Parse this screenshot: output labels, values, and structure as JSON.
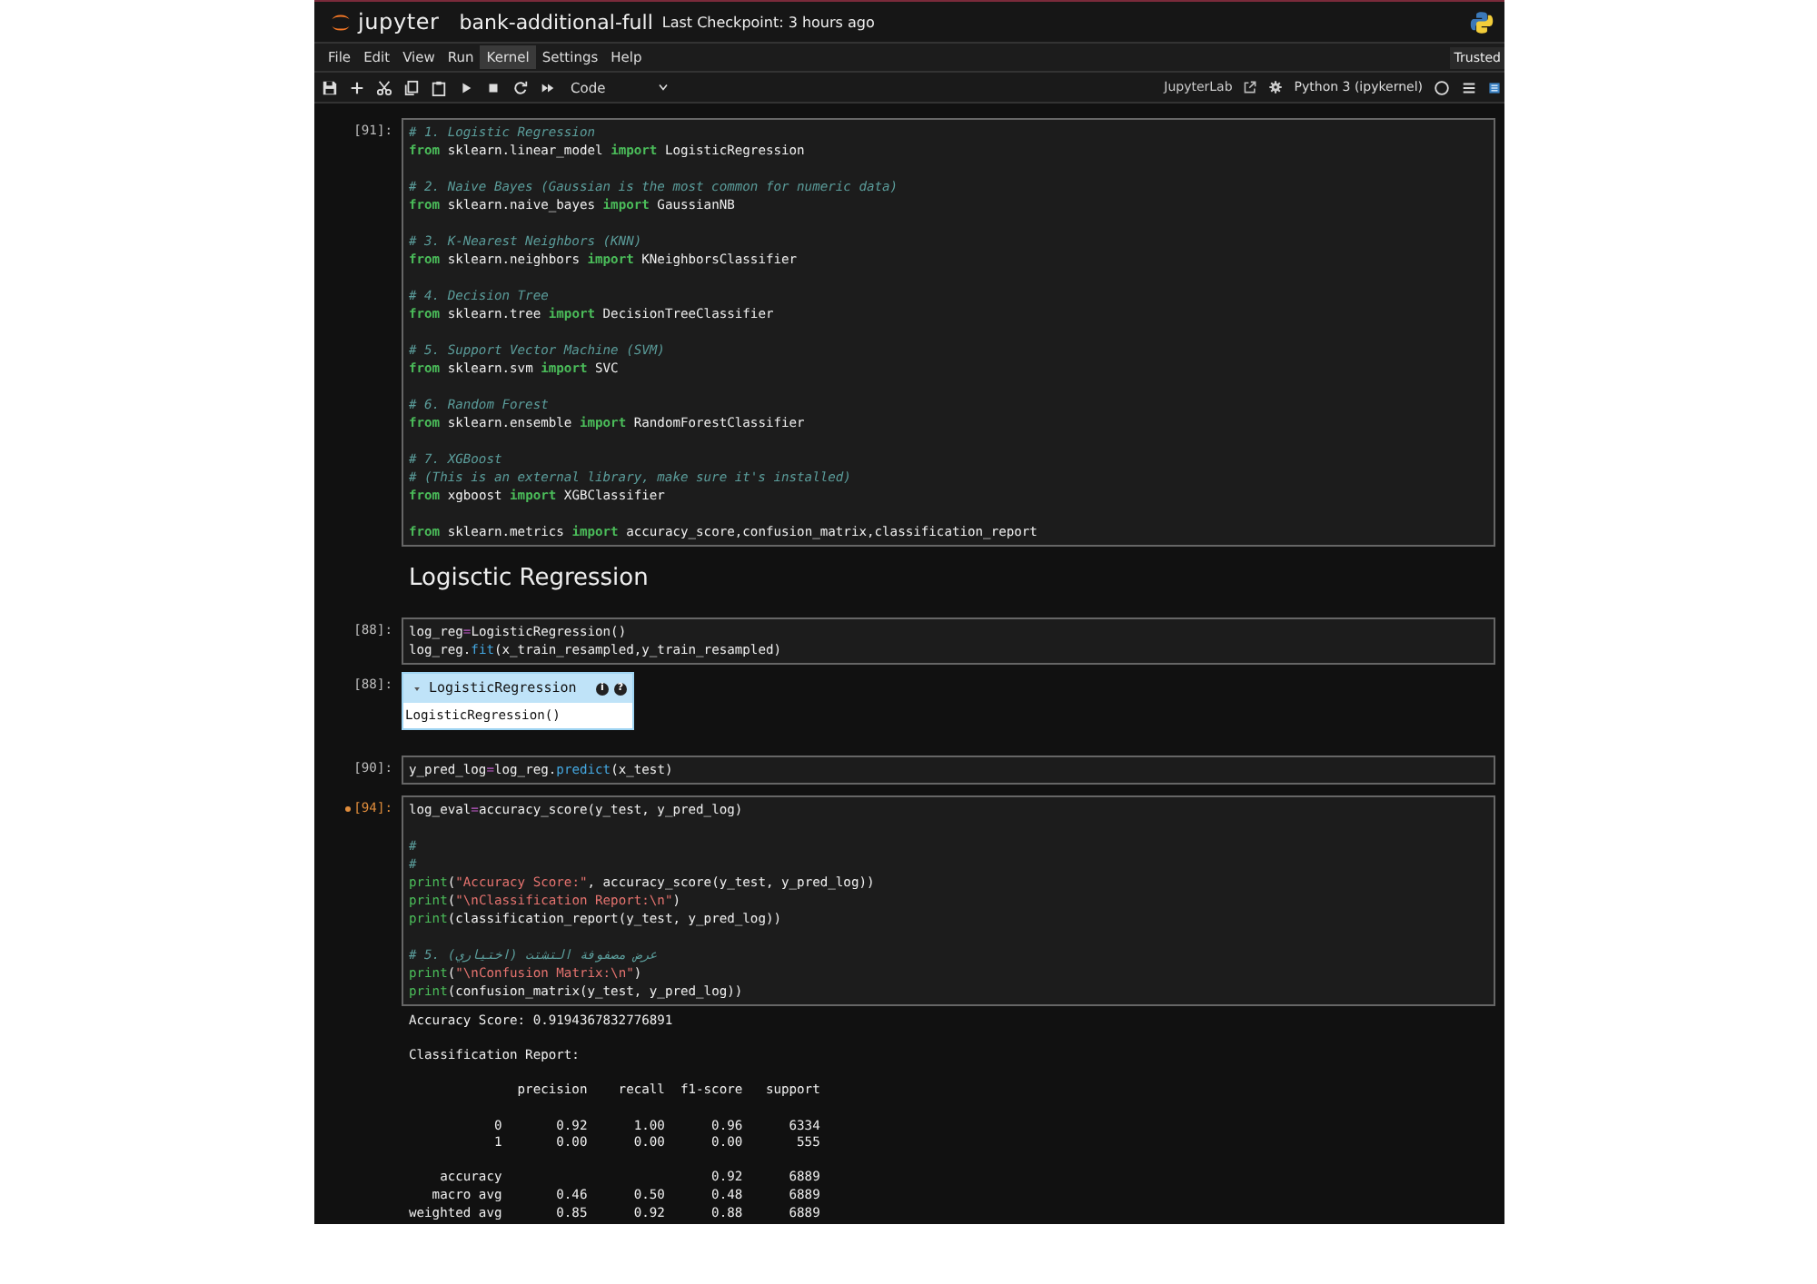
{
  "header": {
    "logo_text": "jupyter",
    "notebook_name": "bank-additional-full",
    "checkpoint": "Last Checkpoint: 3 hours ago"
  },
  "menu": [
    {
      "label": "File",
      "selected": false
    },
    {
      "label": "Edit",
      "selected": false
    },
    {
      "label": "View",
      "selected": false
    },
    {
      "label": "Run",
      "selected": false
    },
    {
      "label": "Kernel",
      "selected": true
    },
    {
      "label": "Settings",
      "selected": false
    },
    {
      "label": "Help",
      "selected": false
    }
  ],
  "trusted": "Trusted",
  "toolbar": {
    "cell_type": "Code",
    "jupyterlab_link": "JupyterLab",
    "kernel": "Python 3 (ipykernel)"
  },
  "cells": [
    {
      "kind": "code",
      "prompt": "[91]:",
      "modified": false,
      "blocks": [
        [
          [
            {
              "kind": "cm",
              "text": "# 1. Logistic Regression"
            }
          ],
          [
            {
              "kind": "kw",
              "text": "from"
            },
            {
              "kind": "pl",
              "text": " sklearn.linear_model "
            },
            {
              "kind": "kw",
              "text": "import"
            },
            {
              "kind": "pl",
              "text": " LogisticRegression"
            }
          ]
        ],
        [
          [
            {
              "kind": "cm",
              "text": "# 2. Naive Bayes (Gaussian is the most common for numeric data)"
            }
          ],
          [
            {
              "kind": "kw",
              "text": "from"
            },
            {
              "kind": "pl",
              "text": " sklearn.naive_bayes "
            },
            {
              "kind": "kw",
              "text": "import"
            },
            {
              "kind": "pl",
              "text": " GaussianNB"
            }
          ]
        ],
        [
          [
            {
              "kind": "cm",
              "text": "# 3. K-Nearest Neighbors (KNN)"
            }
          ],
          [
            {
              "kind": "kw",
              "text": "from"
            },
            {
              "kind": "pl",
              "text": " sklearn.neighbors "
            },
            {
              "kind": "kw",
              "text": "import"
            },
            {
              "kind": "pl",
              "text": " KNeighborsClassifier"
            }
          ]
        ],
        [
          [
            {
              "kind": "cm",
              "text": "# 4. Decision Tree"
            }
          ],
          [
            {
              "kind": "kw",
              "text": "from"
            },
            {
              "kind": "pl",
              "text": " sklearn.tree "
            },
            {
              "kind": "kw",
              "text": "import"
            },
            {
              "kind": "pl",
              "text": " DecisionTreeClassifier"
            }
          ]
        ],
        [
          [
            {
              "kind": "cm",
              "text": "# 5. Support Vector Machine (SVM)"
            }
          ],
          [
            {
              "kind": "kw",
              "text": "from"
            },
            {
              "kind": "pl",
              "text": " sklearn.svm "
            },
            {
              "kind": "kw",
              "text": "import"
            },
            {
              "kind": "pl",
              "text": " SVC"
            }
          ]
        ],
        [
          [
            {
              "kind": "cm",
              "text": "# 6. Random Forest"
            }
          ],
          [
            {
              "kind": "kw",
              "text": "from"
            },
            {
              "kind": "pl",
              "text": " sklearn.ensemble "
            },
            {
              "kind": "kw",
              "text": "import"
            },
            {
              "kind": "pl",
              "text": " RandomForestClassifier"
            }
          ]
        ],
        [
          [
            {
              "kind": "cm",
              "text": "# 7. XGBoost"
            }
          ],
          [
            {
              "kind": "cm",
              "text": "# (This is an external library, make sure it's installed)"
            }
          ],
          [
            {
              "kind": "kw",
              "text": "from"
            },
            {
              "kind": "pl",
              "text": " xgboost "
            },
            {
              "kind": "kw",
              "text": "import"
            },
            {
              "kind": "pl",
              "text": " XGBClassifier"
            }
          ]
        ],
        [
          [
            {
              "kind": "kw",
              "text": "from"
            },
            {
              "kind": "pl",
              "text": " sklearn.metrics "
            },
            {
              "kind": "kw",
              "text": "import"
            },
            {
              "kind": "pl",
              "text": " accuracy_score,confusion_matrix,classification_report"
            }
          ]
        ]
      ]
    },
    {
      "kind": "markdown",
      "heading": "Logisctic Regression"
    },
    {
      "kind": "code",
      "prompt": "[88]:",
      "modified": false,
      "blocks": [
        [
          [
            {
              "kind": "pl",
              "text": "log_reg"
            },
            {
              "kind": "op",
              "text": "="
            },
            {
              "kind": "pl",
              "text": "LogisticRegression()"
            }
          ],
          [
            {
              "kind": "pl",
              "text": "log_reg."
            },
            {
              "kind": "fn",
              "text": "fit"
            },
            {
              "kind": "pl",
              "text": "(x_train_resampled,y_train_resampled)"
            }
          ]
        ]
      ],
      "outputs": [
        {
          "kind": "estimator",
          "prompt": "[88]:",
          "name": "LogisticRegression",
          "expanded": true,
          "icons": [
            "i",
            "?"
          ],
          "repr": "LogisticRegression()"
        }
      ]
    },
    {
      "kind": "code",
      "prompt": "[90]:",
      "modified": false,
      "blocks": [
        [
          [
            {
              "kind": "pl",
              "text": "y_pred_log"
            },
            {
              "kind": "op",
              "text": "="
            },
            {
              "kind": "pl",
              "text": "log_reg."
            },
            {
              "kind": "fn",
              "text": "predict"
            },
            {
              "kind": "pl",
              "text": "(x_test)"
            }
          ]
        ]
      ]
    },
    {
      "kind": "code",
      "prompt": "[94]:",
      "modified": true,
      "blocks": [
        [
          [
            {
              "kind": "pl",
              "text": "log_eval"
            },
            {
              "kind": "op",
              "text": "="
            },
            {
              "kind": "pl",
              "text": "accuracy_score(y_test, y_pred_log)"
            }
          ]
        ],
        [
          [
            {
              "kind": "cm",
              "text": "#"
            }
          ],
          [
            {
              "kind": "cm",
              "text": "#"
            }
          ],
          [
            {
              "kind": "bi",
              "text": "print"
            },
            {
              "kind": "pl",
              "text": "("
            },
            {
              "kind": "str",
              "text": "\"Accuracy Score:\""
            },
            {
              "kind": "pl",
              "text": ", accuracy_score(y_test, y_pred_log))"
            }
          ],
          [
            {
              "kind": "bi",
              "text": "print"
            },
            {
              "kind": "pl",
              "text": "("
            },
            {
              "kind": "str",
              "text": "\"\\nClassification Report:\\n\""
            },
            {
              "kind": "pl",
              "text": ")"
            }
          ],
          [
            {
              "kind": "bi",
              "text": "print"
            },
            {
              "kind": "pl",
              "text": "(classification_report(y_test, y_pred_log))"
            }
          ]
        ],
        [
          [
            {
              "kind": "cm",
              "text": "# 5. عرض مصفوفة التشتت (اختياري)"
            }
          ],
          [
            {
              "kind": "bi",
              "text": "print"
            },
            {
              "kind": "pl",
              "text": "("
            },
            {
              "kind": "str",
              "text": "\"\\nConfusion Matrix:\\n\""
            },
            {
              "kind": "pl",
              "text": ")"
            }
          ],
          [
            {
              "kind": "bi",
              "text": "print"
            },
            {
              "kind": "pl",
              "text": "(confusion_matrix(y_test, y_pred_log))"
            }
          ]
        ]
      ],
      "outputs": [
        {
          "kind": "stream",
          "text": "Accuracy Score: 0.9194367832776891\n\nClassification Report:\n\n              precision    recall  f1-score   support\n\n           0       0.92      1.00      0.96      6334\n           1       0.00      0.00      0.00       555\n\n    accuracy                           0.92      6889\n   macro avg       0.46      0.50      0.48      6889\nweighted avg       0.85      0.92      0.88      6889"
        }
      ]
    }
  ]
}
